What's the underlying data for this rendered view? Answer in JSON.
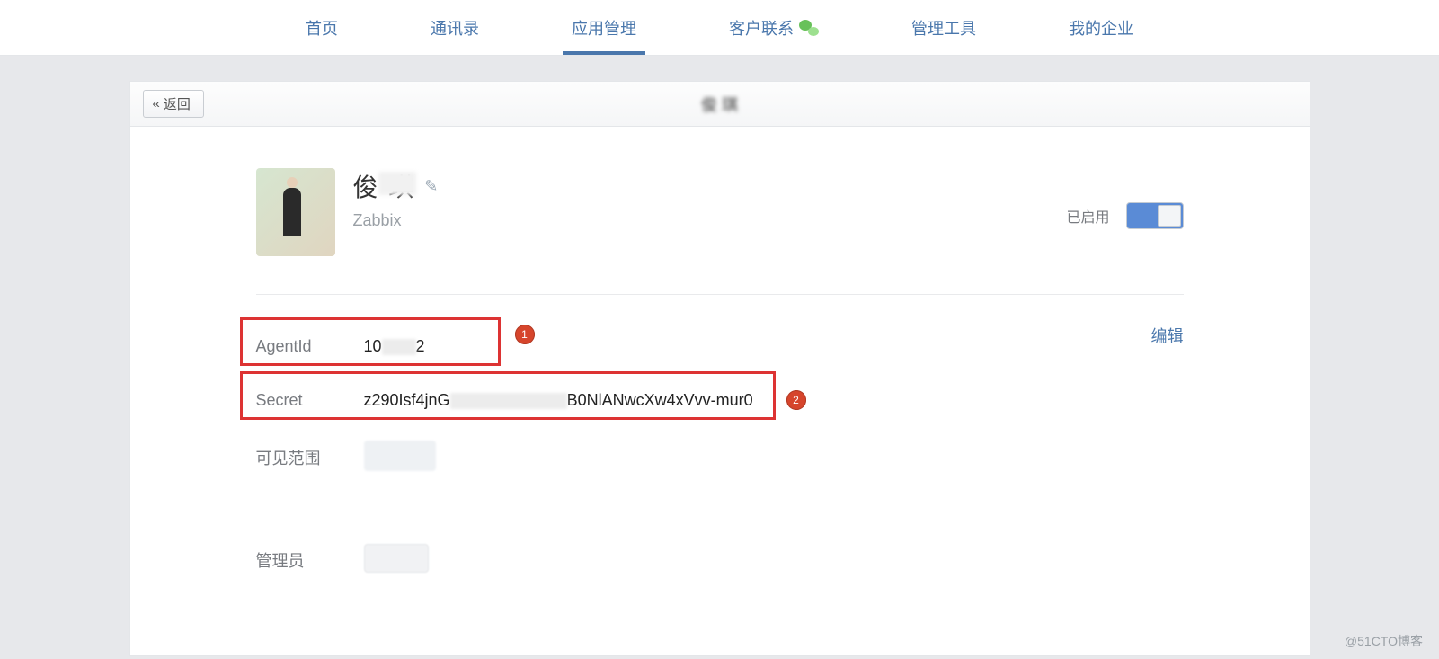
{
  "nav": {
    "items": [
      {
        "label": "首页"
      },
      {
        "label": "通讯录"
      },
      {
        "label": "应用管理",
        "active": true
      },
      {
        "label": "客户联系",
        "icon": "wechat-icon"
      },
      {
        "label": "管理工具"
      },
      {
        "label": "我的企业"
      }
    ]
  },
  "panel": {
    "back_label": "返回",
    "title_blurred": "俊 琪"
  },
  "app": {
    "name": "俊  琪",
    "subtitle": "Zabbix",
    "enabled_label": "已启用",
    "enabled": true
  },
  "info": {
    "agentid_label": "AgentId",
    "agentid_value_prefix": "10",
    "agentid_value_suffix": "2",
    "secret_label": "Secret",
    "secret_value_prefix": "z290Isf4jnG",
    "secret_value_suffix": "B0NlANwcXw4xVvv-mur0",
    "visible_scope_label": "可见范围",
    "admin_label": "管理员",
    "edit_link": "编辑"
  },
  "annotations": {
    "badge1": "1",
    "badge2": "2"
  },
  "watermark": "@51CTO博客"
}
